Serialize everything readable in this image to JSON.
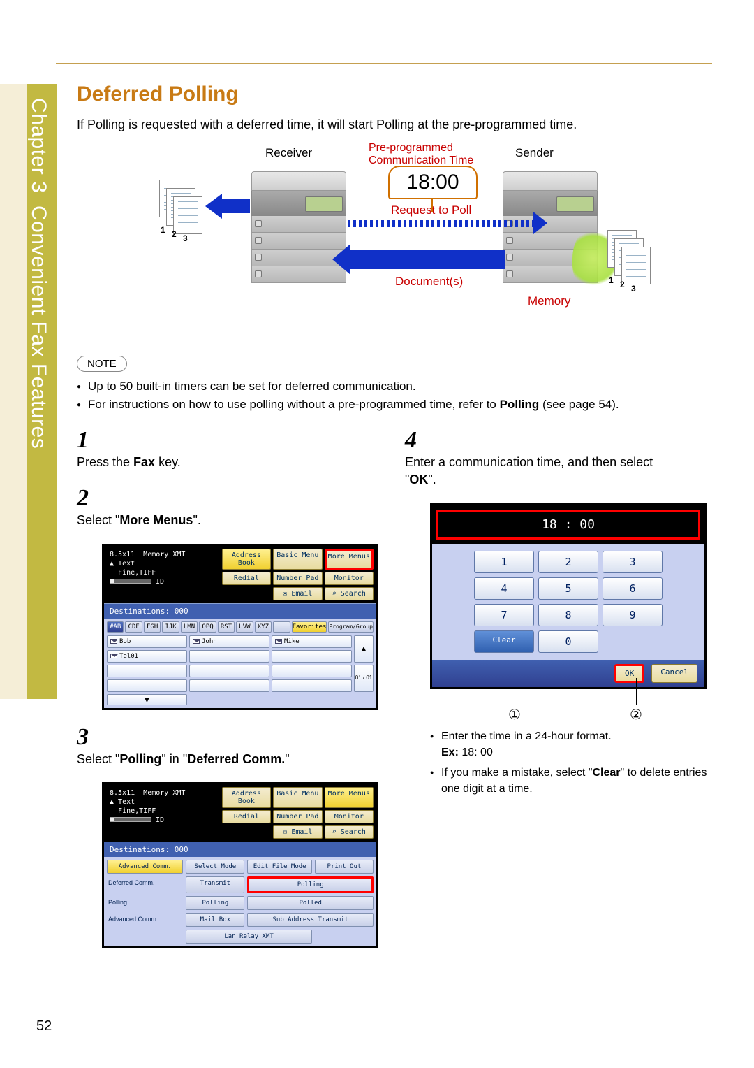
{
  "chapter": {
    "prefix": "Chapter",
    "number": "3",
    "title": "Convenient Fax Features"
  },
  "section_title": "Deferred Polling",
  "intro": "If Polling is requested with a deferred time, it will start Polling at the pre-programmed time.",
  "diagram": {
    "receiver": "Receiver",
    "sender": "Sender",
    "preprog": "Pre-programmed\nCommunication Time",
    "time": "18:00",
    "request": "Request to Poll",
    "documents": "Document(s)",
    "memory": "Memory"
  },
  "note_label": "NOTE",
  "notes": [
    "Up to 50 built-in timers can be set for deferred communication.",
    "For instructions on how to use polling without a pre-programmed time, refer to Polling (see page 54)."
  ],
  "steps": {
    "s1": {
      "n": "1",
      "text_a": "Press the ",
      "bold": "Fax",
      "text_b": " key."
    },
    "s2": {
      "n": "2",
      "text_a": "Select \"",
      "bold": "More Menus",
      "text_b": "\"."
    },
    "s3": {
      "n": "3",
      "text_a": "Select \"",
      "bold1": "Polling",
      "mid": "\" in \"",
      "bold2": "Deferred Comm.",
      "text_b": "\""
    },
    "s4": {
      "n": "4",
      "text_a": "Enter a communication time, and then select \"",
      "bold": "OK",
      "text_b": "\"."
    }
  },
  "ss2": {
    "status": {
      "size": "8.5x11",
      "memory": "Memory XMT",
      "text": "Text",
      "fine": "Fine,TIFF",
      "id": "ID"
    },
    "tabs": [
      "Address Book",
      "Basic Menu",
      "More Menus",
      "Redial",
      "Number Pad",
      "Monitor",
      "Email",
      "Search"
    ],
    "dest": "Destinations: 000",
    "alpha": [
      "#AB",
      "CDE",
      "FGH",
      "IJK",
      "LMN",
      "OPQ",
      "RST",
      "UVW",
      "XYZ",
      "",
      "Favorites",
      "Program/Group"
    ],
    "entries": [
      "Bob",
      "John",
      "Mike",
      "Tel01"
    ],
    "scroll": "01 / 01"
  },
  "ss3": {
    "status": {
      "size": "8.5x11",
      "memory": "Memory XMT",
      "text": "Text",
      "fine": "Fine,TIFF",
      "id": "ID"
    },
    "tabs": [
      "Address Book",
      "Basic Menu",
      "More Menus",
      "Redial",
      "Number Pad",
      "Monitor",
      "Email",
      "Search"
    ],
    "dest": "Destinations: 000",
    "menu_headers": [
      "Advanced Comm.",
      "Select Mode",
      "Edit File Mode",
      "Print Out"
    ],
    "rows": [
      {
        "label": "Deferred Comm.",
        "a": "Transmit",
        "b": "Polling"
      },
      {
        "label": "Polling",
        "a": "Polling",
        "b": "Polled"
      },
      {
        "label": "Advanced Comm.",
        "a": "Mail Box",
        "b": "Sub Address Transmit"
      },
      {
        "label": "",
        "a": "Lan Relay XMT",
        "b": ""
      }
    ]
  },
  "numpad": {
    "display": "18 : 00",
    "keys": [
      "1",
      "2",
      "3",
      "4",
      "5",
      "6",
      "7",
      "8",
      "9",
      "Clear",
      "0"
    ],
    "ok": "OK",
    "cancel": "Cancel"
  },
  "circles": {
    "c1": "①",
    "c2": "②"
  },
  "subnotes": [
    {
      "pre": "Enter the time in a 24-hour format.",
      "ex_label": "Ex:",
      "ex_val": " 18: 00"
    },
    {
      "pre": "If you make a mistake, select \"",
      "bold": "Clear",
      "post": "\" to delete entries one digit at a time."
    }
  ],
  "page_number": "52"
}
